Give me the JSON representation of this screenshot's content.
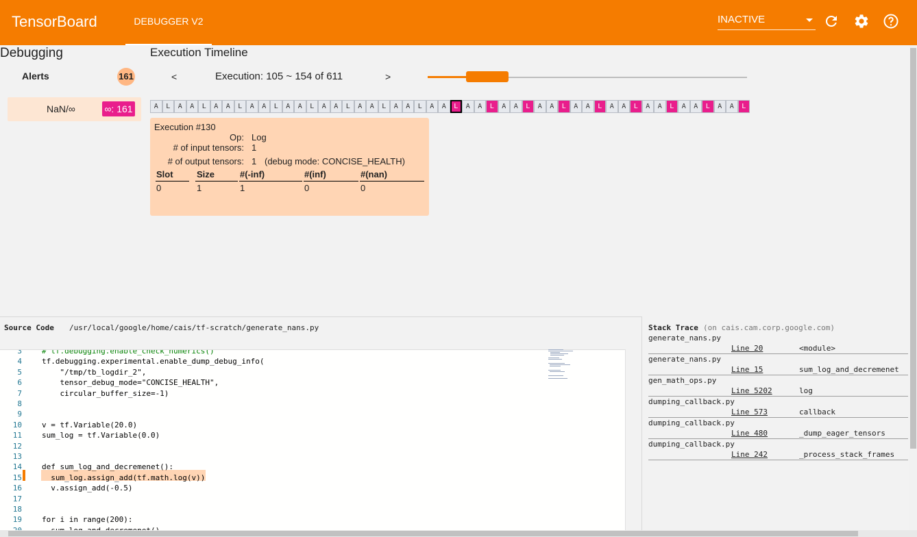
{
  "app": {
    "title": "TensorBoard",
    "active_tab": "DEBUGGER V2",
    "run_status": "INACTIVE"
  },
  "icons": {
    "refresh": "refresh-icon",
    "settings": "gear-icon",
    "help": "help-icon",
    "run_dropdown": "chevron-down-icon"
  },
  "colors": {
    "brand": "#f57c00",
    "alert_highlight": "#e91e8c",
    "card": "#ffd5b4",
    "alerts_badge": "#ffb783"
  },
  "alerts": {
    "section_title": "Debugging",
    "label": "Alerts",
    "count": "161",
    "items": [
      {
        "type": "NaN/∞",
        "count": "∞: 161"
      }
    ]
  },
  "timeline": {
    "title": "Execution Timeline",
    "prev": "<",
    "next": ">",
    "label": "Execution: 105 ~ 154 of 611",
    "range_start": 105,
    "range_end": 154,
    "total": 611,
    "cells": [
      "A",
      "L",
      "A",
      "A",
      "L",
      "A",
      "A",
      "L",
      "A",
      "A",
      "L",
      "A",
      "A",
      "L",
      "A",
      "A",
      "L",
      "A",
      "A",
      "L",
      "A",
      "A",
      "L",
      "A",
      "A",
      "L",
      "A",
      "A",
      "L",
      "A",
      "A",
      "L",
      "A",
      "A",
      "L",
      "A",
      "A",
      "L",
      "A",
      "A",
      "L",
      "A",
      "A",
      "L",
      "A",
      "A",
      "L",
      "A",
      "A",
      "L"
    ],
    "alert_cells": [
      25,
      28,
      31,
      34,
      37,
      40,
      43,
      46,
      49
    ],
    "selected_cell": 25
  },
  "execution": {
    "title": "Execution #130",
    "op_label": "Op:",
    "op": "Log",
    "inputs_label": "# of input tensors:",
    "inputs": "1",
    "outputs_label": "# of output tensors:",
    "outputs": "1",
    "debug_mode": "(debug mode: CONCISE_HEALTH)",
    "columns": [
      "Slot",
      "Size",
      "#(-inf)",
      "#(inf)",
      "#(nan)"
    ],
    "rows": [
      [
        "0",
        "1",
        "1",
        "0",
        "0"
      ]
    ]
  },
  "source": {
    "label": "Source Code",
    "path": "/usr/local/google/home/cais/tf-scratch/generate_nans.py",
    "lines": [
      {
        "n": "3",
        "text": "# tf.debugging.enable_check_numerics()"
      },
      {
        "n": "4",
        "text": "tf.debugging.experimental.enable_dump_debug_info("
      },
      {
        "n": "5",
        "text": "    \"/tmp/tb_logdir_2\","
      },
      {
        "n": "6",
        "text": "    tensor_debug_mode=\"CONCISE_HEALTH\","
      },
      {
        "n": "7",
        "text": "    circular_buffer_size=-1)"
      },
      {
        "n": "8",
        "text": ""
      },
      {
        "n": "9",
        "text": ""
      },
      {
        "n": "10",
        "text": "v = tf.Variable(20.0)"
      },
      {
        "n": "11",
        "text": "sum_log = tf.Variable(0.0)"
      },
      {
        "n": "12",
        "text": ""
      },
      {
        "n": "13",
        "text": ""
      },
      {
        "n": "14",
        "text": "def sum_log_and_decremenet():"
      },
      {
        "n": "15",
        "text": "  sum_log.assign_add(tf.math.log(v))"
      },
      {
        "n": "16",
        "text": "  v.assign_add(-0.5)"
      },
      {
        "n": "17",
        "text": ""
      },
      {
        "n": "18",
        "text": ""
      },
      {
        "n": "19",
        "text": "for i in range(200):"
      },
      {
        "n": "20",
        "text": "  sum_log_and_decremenet()"
      }
    ],
    "highlighted_line": "15"
  },
  "stack_trace": {
    "title": "Stack Trace",
    "host": "(on cais.cam.corp.google.com)",
    "frames": [
      {
        "file": "generate_nans.py",
        "line": "Line 20",
        "fn": "<module>"
      },
      {
        "file": "generate_nans.py",
        "line": "Line 15",
        "fn": "sum_log_and_decremenet"
      },
      {
        "file": "gen_math_ops.py",
        "line": "Line 5202",
        "fn": "log"
      },
      {
        "file": "dumping_callback.py",
        "line": "Line 573",
        "fn": "callback"
      },
      {
        "file": "dumping_callback.py",
        "line": "Line 480",
        "fn": "_dump_eager_tensors"
      },
      {
        "file": "dumping_callback.py",
        "line": "Line 242",
        "fn": "_process_stack_frames"
      }
    ]
  }
}
